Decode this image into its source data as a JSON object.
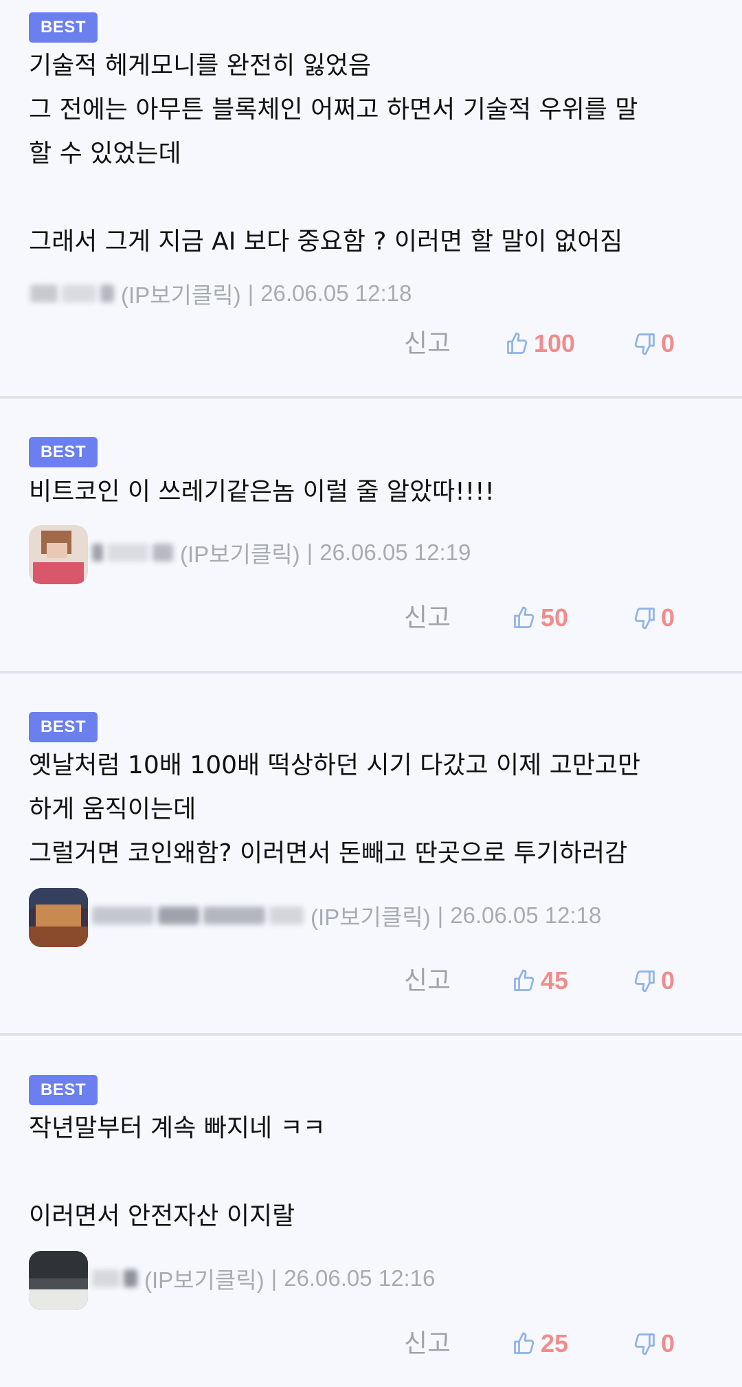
{
  "colors": {
    "background": "#f6f8fd",
    "badge": "#6b7fee",
    "count": "#f08c8c",
    "thumb_icon": "#8fb2e8",
    "meta_text": "#a7abb3",
    "divider": "#dfe2ea"
  },
  "comments": [
    {
      "badge": "BEST",
      "lines": [
        "기술적 헤게모니를 완전히 잃었음",
        "그 전에는 아무튼 블록체인 어쩌고 하면서 기술적 우위를 말",
        "할 수 있었는데",
        "",
        "그래서 그게 지금 AI 보다 중요함 ? 이러면 할 말이 없어짐"
      ],
      "ip": "(IP보기클릭)",
      "sep": "|",
      "date": "26.06.05 12:18",
      "report": "신고",
      "likes": "100",
      "dislikes": "0",
      "like_icon": "thumbs-up-icon",
      "dislike_icon": "thumbs-down-icon"
    },
    {
      "badge": "BEST",
      "lines": [
        "비트코인 이 쓰레기같은놈 이럴 줄 알았따!!!!"
      ],
      "ip": "(IP보기클릭)",
      "sep": "|",
      "date": "26.06.05 12:19",
      "report": "신고",
      "likes": "50",
      "dislikes": "0",
      "like_icon": "thumbs-up-icon",
      "dislike_icon": "thumbs-down-icon"
    },
    {
      "badge": "BEST",
      "lines": [
        "옛날처럼 10배 100배 떡상하던 시기 다갔고 이제 고만고만",
        "하게 움직이는데",
        "그럴거면 코인왜함? 이러면서 돈빼고 딴곳으로 투기하러감"
      ],
      "ip": "(IP보기클릭)",
      "sep": "|",
      "date": "26.06.05 12:18",
      "report": "신고",
      "likes": "45",
      "dislikes": "0",
      "like_icon": "thumbs-up-icon",
      "dislike_icon": "thumbs-down-icon"
    },
    {
      "badge": "BEST",
      "lines": [
        "작년말부터 계속 빠지네 ㅋㅋ",
        "",
        "이러면서 안전자산 이지랄"
      ],
      "ip": "(IP보기클릭)",
      "sep": "|",
      "date": "26.06.05 12:16",
      "report": "신고",
      "likes": "25",
      "dislikes": "0",
      "like_icon": "thumbs-up-icon",
      "dislike_icon": "thumbs-down-icon"
    }
  ]
}
